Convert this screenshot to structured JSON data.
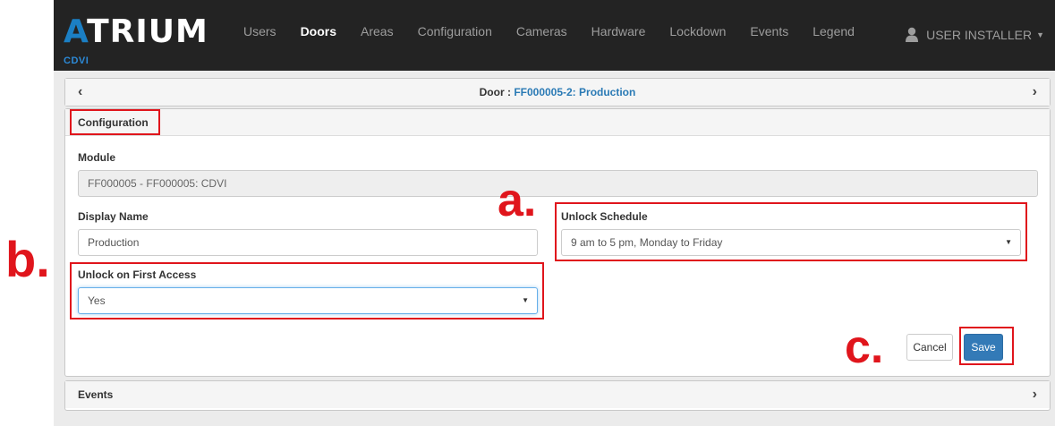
{
  "brand": {
    "logo_accent": "A",
    "logo_rest": "TRIUM",
    "sub": "CDVI"
  },
  "nav": {
    "items": [
      {
        "label": "Users",
        "active": false
      },
      {
        "label": "Doors",
        "active": true
      },
      {
        "label": "Areas",
        "active": false
      },
      {
        "label": "Configuration",
        "active": false
      },
      {
        "label": "Cameras",
        "active": false
      },
      {
        "label": "Hardware",
        "active": false
      },
      {
        "label": "Lockdown",
        "active": false
      },
      {
        "label": "Events",
        "active": false
      },
      {
        "label": "Legend",
        "active": false
      }
    ],
    "user_label": "USER INSTALLER"
  },
  "door_header": {
    "prefix": "Door : ",
    "name": "FF000005-2: Production",
    "prev_icon": "chevron-left-icon",
    "next_icon": "chevron-right-icon"
  },
  "config": {
    "title": "Configuration",
    "module_label": "Module",
    "module_value": "FF000005 - FF000005: CDVI",
    "display_name_label": "Display Name",
    "display_name_value": "Production",
    "unlock_schedule_label": "Unlock Schedule",
    "unlock_schedule_value": "9 am to 5 pm, Monday to Friday",
    "unlock_first_access_label": "Unlock on First Access",
    "unlock_first_access_value": "Yes",
    "cancel_label": "Cancel",
    "save_label": "Save"
  },
  "events_panel": {
    "title": "Events"
  },
  "annotations": {
    "a": "a.",
    "b": "b.",
    "c": "c.",
    "color": "#e0151c"
  },
  "colors": {
    "navbar_bg": "#232323",
    "accent": "#1b7fc4",
    "primary_button": "#337ab7"
  }
}
